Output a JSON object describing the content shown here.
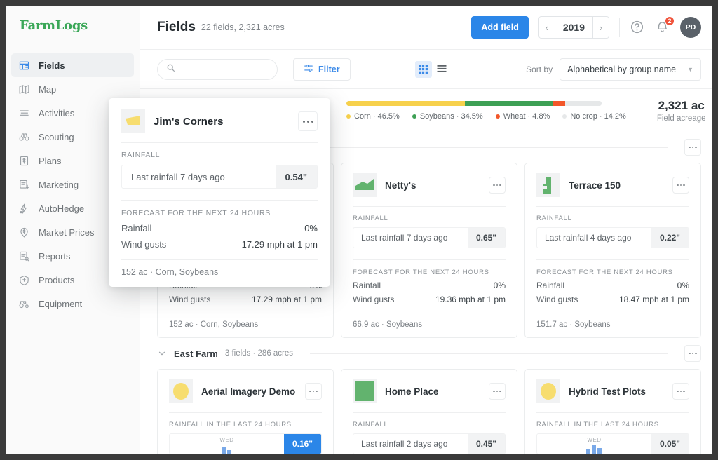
{
  "brand": "FarmLogs",
  "sidebar": {
    "items": [
      {
        "label": "Fields",
        "icon": "fields-icon",
        "active": true
      },
      {
        "label": "Map",
        "icon": "map-icon",
        "active": false
      },
      {
        "label": "Activities",
        "icon": "activities-icon",
        "active": false
      },
      {
        "label": "Scouting",
        "icon": "binoculars-icon",
        "active": false
      },
      {
        "label": "Plans",
        "icon": "plans-icon",
        "active": false
      },
      {
        "label": "Marketing",
        "icon": "marketing-icon",
        "active": false
      },
      {
        "label": "AutoHedge",
        "icon": "autohedge-icon",
        "active": false
      },
      {
        "label": "Market Prices",
        "icon": "market-prices-icon",
        "active": false
      },
      {
        "label": "Reports",
        "icon": "reports-icon",
        "active": false
      },
      {
        "label": "Products",
        "icon": "products-icon",
        "active": false
      },
      {
        "label": "Equipment",
        "icon": "equipment-icon",
        "active": false
      }
    ]
  },
  "header": {
    "title": "Fields",
    "subtitle": "22 fields, 2,321 acres",
    "add_field_label": "Add field",
    "year": "2019",
    "prev_arrow": "‹",
    "next_arrow": "›",
    "help_icon": "help-circle-icon",
    "bell_icon": "notification-bell-icon",
    "notification_count": "2",
    "avatar_initials": "PD",
    "primary_color": "#2b86e8"
  },
  "toolbar": {
    "search_placeholder": "",
    "search_value": "",
    "search_icon": "search-icon",
    "filter_label": "Filter",
    "filter_icon": "filter-sliders-icon",
    "grid_view_icon": "grid-view-icon",
    "list_view_icon": "list-view-icon",
    "active_view": "grid",
    "sort_label": "Sort by",
    "sort_value": "Alphabetical by group name",
    "caret_icon": "chevron-down-icon"
  },
  "crop_summary": {
    "acreage_value": "2,321 ac",
    "acreage_label": "Field acreage",
    "legend": [
      {
        "label": "Corn · 46.5%",
        "name": "Corn",
        "pct": 46.5,
        "color": "#f7d14c"
      },
      {
        "label": "Soybeans · 34.5%",
        "name": "Soybeans",
        "pct": 34.5,
        "color": "#3da055"
      },
      {
        "label": "Wheat · 4.8%",
        "name": "Wheat",
        "pct": 4.8,
        "color": "#f2572a"
      },
      {
        "label": "No crop · 14.2%",
        "name": "No crop",
        "pct": 14.2,
        "color": "#e6e8e9"
      }
    ]
  },
  "popup": {
    "name": "Jim's Corners",
    "thumb_color": "#f7dd6f",
    "menu_icon": "more-options-icon",
    "rainfall_label": "RAINFALL",
    "rainfall_text": "Last rainfall 7 days ago",
    "rainfall_value": "0.54\"",
    "forecast_label": "FORECAST FOR THE NEXT 24 HOURS",
    "forecast": [
      {
        "key": "Rainfall",
        "value": "0%"
      },
      {
        "key": "Wind gusts",
        "value": "17.29 mph at 1 pm"
      }
    ],
    "footer": "152 ac · Corn, Soybeans"
  },
  "groups": [
    {
      "name": "",
      "subtitle": "",
      "menu_icon": "more-options-icon",
      "chevron_icon": "chevron-down-icon",
      "cards": [
        {
          "name": "Jim's Corners",
          "thumb_color": "#f7dd6f",
          "thumb_shape": "polygon",
          "menu_icon": "more-options-icon",
          "rainfall_label": "RAINFALL",
          "rainfall_mode": "text",
          "rainfall_text": "Last rainfall 7 days ago",
          "rainfall_value": "0.54\"",
          "value_highlight": false,
          "forecast_label": "FORECAST FOR THE NEXT 24 HOURS",
          "forecast": [
            {
              "key": "Rainfall",
              "value": "0%"
            },
            {
              "key": "Wind gusts",
              "value": "17.29 mph at 1 pm"
            }
          ],
          "footer": "152 ac · Corn, Soybeans"
        },
        {
          "name": "Netty's",
          "thumb_color": "#62b36e",
          "thumb_shape": "hill",
          "menu_icon": "more-options-icon",
          "rainfall_label": "RAINFALL",
          "rainfall_mode": "text",
          "rainfall_text": "Last rainfall 7 days ago",
          "rainfall_value": "0.65\"",
          "value_highlight": false,
          "forecast_label": "FORECAST FOR THE NEXT 24 HOURS",
          "forecast": [
            {
              "key": "Rainfall",
              "value": "0%"
            },
            {
              "key": "Wind gusts",
              "value": "19.36 mph at 1 pm"
            }
          ],
          "footer": "66.9 ac · Soybeans"
        },
        {
          "name": "Terrace 150",
          "thumb_color": "#62b36e",
          "thumb_shape": "terrace",
          "menu_icon": "more-options-icon",
          "rainfall_label": "RAINFALL",
          "rainfall_mode": "text",
          "rainfall_text": "Last rainfall 4 days ago",
          "rainfall_value": "0.22\"",
          "value_highlight": false,
          "forecast_label": "FORECAST FOR THE NEXT 24 HOURS",
          "forecast": [
            {
              "key": "Rainfall",
              "value": "0%"
            },
            {
              "key": "Wind gusts",
              "value": "18.47 mph at 1 pm"
            }
          ],
          "footer": "151.7 ac · Soybeans"
        }
      ]
    },
    {
      "name": "East Farm",
      "subtitle": "3 fields · 286 acres",
      "menu_icon": "more-options-icon",
      "chevron_icon": "chevron-down-icon",
      "cards": [
        {
          "name": "Aerial Imagery Demo",
          "thumb_color": "#f7dd6f",
          "thumb_shape": "circle",
          "menu_icon": "more-options-icon",
          "rainfall_label": "RAINFALL IN THE LAST 24 HOURS",
          "rainfall_mode": "chart",
          "chart_day_label": "WED",
          "chart_bars": [
            10,
            5
          ],
          "rainfall_value": "0.16\"",
          "value_highlight": true,
          "forecast_label": "",
          "forecast": [],
          "footer": ""
        },
        {
          "name": "Home Place",
          "thumb_color": "#62b36e",
          "thumb_shape": "square",
          "menu_icon": "more-options-icon",
          "rainfall_label": "RAINFALL",
          "rainfall_mode": "text",
          "rainfall_text": "Last rainfall 2 days ago",
          "rainfall_value": "0.45\"",
          "value_highlight": false,
          "forecast_label": "",
          "forecast": [],
          "footer": ""
        },
        {
          "name": "Hybrid Test Plots",
          "thumb_color": "#f7dd6f",
          "thumb_shape": "circle",
          "menu_icon": "more-options-icon",
          "rainfall_label": "RAINFALL IN THE LAST 24 HOURS",
          "rainfall_mode": "chart",
          "chart_day_label": "WED",
          "chart_bars": [
            6,
            12,
            8
          ],
          "rainfall_value": "0.05\"",
          "value_highlight": false,
          "forecast_label": "",
          "forecast": [],
          "footer": ""
        }
      ]
    }
  ]
}
